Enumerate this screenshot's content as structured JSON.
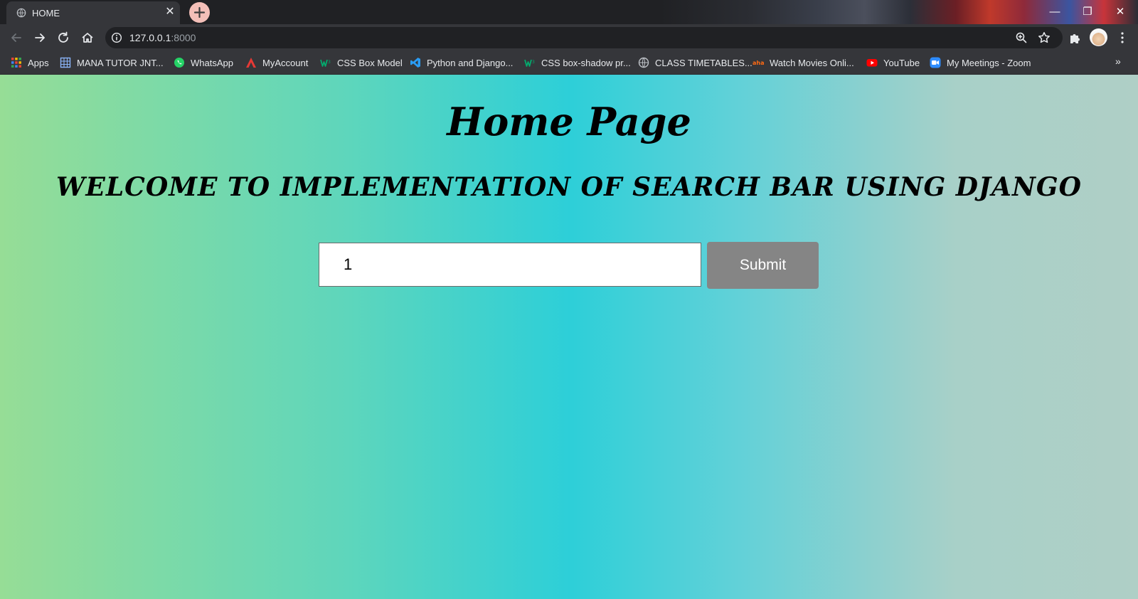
{
  "browser": {
    "tab": {
      "title": "HOME",
      "favicon": "globe-icon",
      "close_icon": "close-icon"
    },
    "new_tab_icon": "plus-icon",
    "window_controls": {
      "minimize": "—",
      "restore": "❐",
      "close": "✕"
    },
    "omnibox": {
      "host": "127.0.0.1",
      "port": ":8000"
    },
    "toolbar_icons": [
      "back-arrow-icon",
      "forward-arrow-icon",
      "reload-icon",
      "home-icon",
      "info-icon",
      "zoom-icon",
      "star-icon",
      "extensions-icon",
      "avatar",
      "menu-icon"
    ],
    "bookmarks": [
      {
        "label": "Apps",
        "icon": "apps-grid-icon"
      },
      {
        "label": "MANA TUTOR JNT...",
        "icon": "table-icon"
      },
      {
        "label": "WhatsApp",
        "icon": "whatsapp-icon"
      },
      {
        "label": "MyAccount",
        "icon": "myaccount-icon"
      },
      {
        "label": "CSS Box Model",
        "icon": "w3schools-icon"
      },
      {
        "label": "Python and Django...",
        "icon": "vscode-icon"
      },
      {
        "label": "CSS box-shadow pr...",
        "icon": "w3schools-icon"
      },
      {
        "label": "CLASS TIMETABLES...",
        "icon": "globe-icon"
      },
      {
        "label": "Watch Movies Onli...",
        "icon": "aha-icon"
      },
      {
        "label": "YouTube",
        "icon": "youtube-icon"
      },
      {
        "label": "My Meetings - Zoom",
        "icon": "zoom-icon"
      }
    ],
    "more_bookmarks": "»"
  },
  "page": {
    "title": "Home Page",
    "welcome": "WELCOME TO IMPLEMENTATION OF SEARCH BAR USING DJANGO",
    "search": {
      "value": "1"
    },
    "submit_label": "Submit"
  },
  "colors": {
    "gradient": [
      "#96dd96",
      "#5fd6bb",
      "#2dcfd8",
      "#62d1d8",
      "#a8d0c8",
      "#afcfc6"
    ],
    "submit_bg": "#858585",
    "chrome_bg": "#35363a"
  }
}
